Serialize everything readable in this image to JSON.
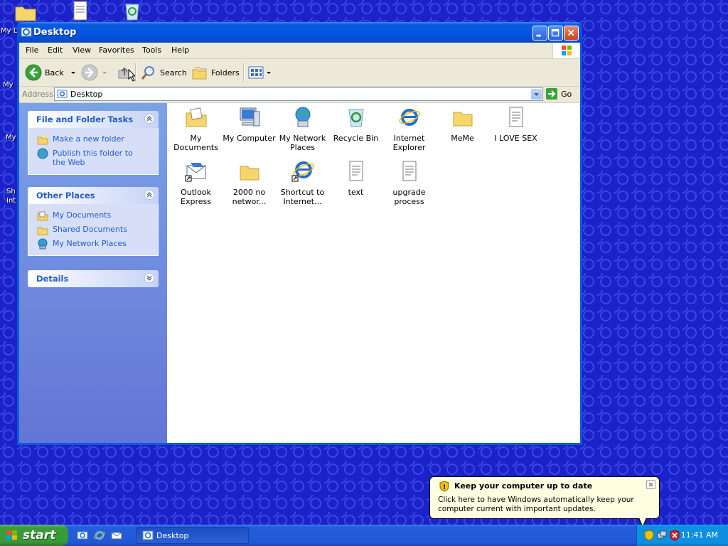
{
  "desktop": {
    "left_labels": [
      "My D",
      "My",
      "My",
      "Sh",
      "Int"
    ]
  },
  "window": {
    "title": "Desktop",
    "menu": [
      "File",
      "Edit",
      "View",
      "Favorites",
      "Tools",
      "Help"
    ],
    "toolbar": {
      "back": "Back",
      "search": "Search",
      "folders": "Folders"
    },
    "address": {
      "label": "Address",
      "value": "Desktop",
      "go": "Go"
    }
  },
  "taskpane": {
    "file_tasks": {
      "title": "File and Folder Tasks",
      "items": [
        {
          "label": "Make a new folder",
          "icon": "new-folder-icon"
        },
        {
          "label": "Publish this folder to the Web",
          "icon": "publish-web-icon"
        }
      ]
    },
    "other_places": {
      "title": "Other Places",
      "items": [
        {
          "label": "My Documents",
          "icon": "my-documents-icon"
        },
        {
          "label": "Shared Documents",
          "icon": "shared-documents-icon"
        },
        {
          "label": "My Network Places",
          "icon": "network-places-icon"
        }
      ]
    },
    "details": {
      "title": "Details"
    }
  },
  "files": [
    {
      "label": "My Documents",
      "icon": "my-documents-folder-icon"
    },
    {
      "label": "My Computer",
      "icon": "my-computer-icon"
    },
    {
      "label": "My Network Places",
      "icon": "network-places-icon"
    },
    {
      "label": "Recycle Bin",
      "icon": "recycle-bin-icon"
    },
    {
      "label": "Internet Explorer",
      "icon": "internet-explorer-icon"
    },
    {
      "label": "MeMe",
      "icon": "folder-icon"
    },
    {
      "label": "I LOVE SEX",
      "icon": "text-document-icon"
    },
    {
      "label": "Outlook Express",
      "icon": "outlook-express-icon"
    },
    {
      "label": "2000 no networ...",
      "icon": "folder-icon"
    },
    {
      "label": "Shortcut to Internet...",
      "icon": "internet-explorer-shortcut-icon"
    },
    {
      "label": "text",
      "icon": "text-document-icon"
    },
    {
      "label": "upgrade process",
      "icon": "text-document-icon"
    }
  ],
  "balloon": {
    "title": "Keep your computer up to date",
    "body": "Click here to have Windows automatically keep your computer current with important updates."
  },
  "taskbar": {
    "start": "start",
    "task_button": "Desktop",
    "clock": "11:41 AM"
  },
  "colors": {
    "desktop_bg": "#1a22c8",
    "titlebar": "#0554e2",
    "taskpane_link": "#215dc6",
    "start_green": "#3c9a3c"
  }
}
